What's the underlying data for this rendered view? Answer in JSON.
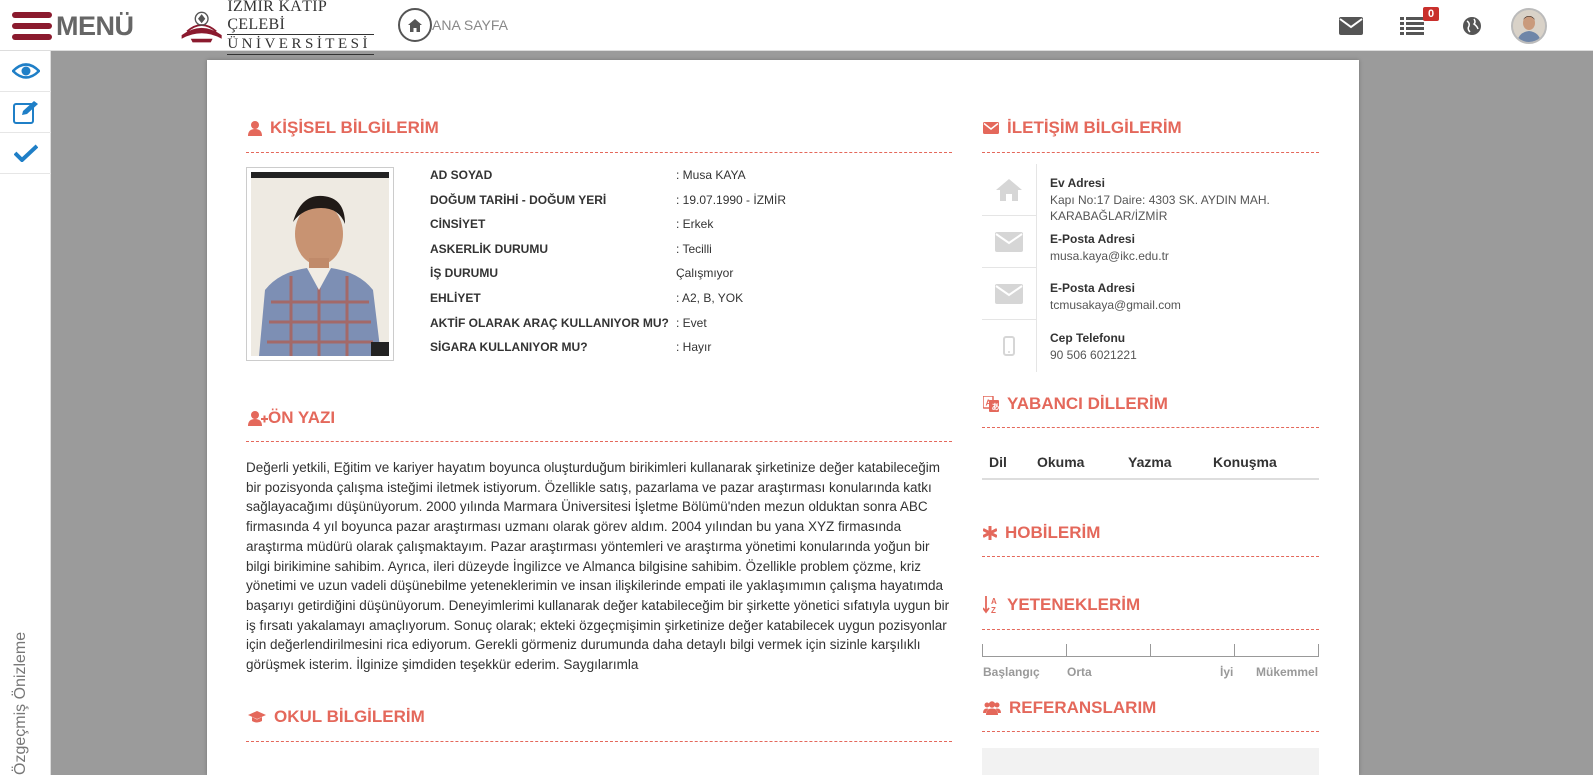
{
  "topbar": {
    "menu_label": "MENÜ",
    "logo_line1": "İZMİR KÂTİP ÇELEBİ",
    "logo_line2": "ÜNİVERSİTESİ",
    "home_label": "ANA SAYFA",
    "notifications_count": "0",
    "icons": [
      "envelope-icon",
      "list-icon",
      "globe-icon"
    ]
  },
  "sidebar": {
    "items": [
      "eye-icon",
      "edit-icon",
      "check-icon"
    ],
    "vertical_label": "Özgeçmiş Önizleme"
  },
  "personal": {
    "title": "KİŞİSEL BİLGİLERİM",
    "rows": [
      {
        "label": "AD SOYAD",
        "value": ": Musa KAYA"
      },
      {
        "label": "DOĞUM TARİHİ - DOĞUM YERİ",
        "value": ": 19.07.1990 - İZMİR"
      },
      {
        "label": "CİNSİYET",
        "value": ": Erkek"
      },
      {
        "label": "ASKERLİK DURUMU",
        "value": ": Tecilli"
      },
      {
        "label": "İŞ DURUMU",
        "value": " Çalışmıyor"
      },
      {
        "label": "EHLİYET",
        "value": " : A2, B, YOK"
      },
      {
        "label": "AKTİF OLARAK ARAÇ KULLANIYOR MU?",
        "value": ": Evet"
      },
      {
        "label": "SİGARA KULLANIYOR MU?",
        "value": ": Hayır"
      }
    ]
  },
  "cover_letter": {
    "title": "ÖN YAZI",
    "text": "Değerli yetkili, Eğitim ve kariyer hayatım boyunca oluşturduğum birikimleri kullanarak şirketinize değer katabileceğim bir pozisyonda çalışma isteğimi iletmek istiyorum. Özellikle satış, pazarlama ve pazar araştırması konularında katkı sağlayacağımı düşünüyorum. 2000 yılında Marmara Üniversitesi İşletme Bölümü'nden mezun olduktan sonra ABC firmasında 4 yıl boyunca pazar araştırması uzmanı olarak görev aldım. 2004 yılından bu yana XYZ firmasında araştırma müdürü olarak çalışmaktayım. Pazar araştırması yöntemleri ve araştırma yönetimi konularında yoğun bir bilgi birikimine sahibim. Ayrıca, ileri düzeyde İngilizce ve Almanca bilgisine sahibim. Özellikle problem çözme, kriz yönetimi ve uzun vadeli düşünebilme yeteneklerimin ve insan ilişkilerinde empati ile yaklaşımımın çalışma hayatımda başarıyı getirdiğini düşünüyorum. Deneyimlerimi kullanarak değer katabileceğim bir şirkette yönetici sıfatıyla uygun bir iş fırsatı yakalamayı amaçlıyorum. Sonuç olarak; ekteki özgeçmişimin şirketinize değer katabilecek uygun pozisyonlar için değerlendirilmesini rica ediyorum. Gerekli görmeniz durumunda daha detaylı bilgi vermek için sizinle karşılıklı görüşmek isterim. İlginize şimdiden teşekkür ederim. Saygılarımla"
  },
  "school": {
    "title": "OKUL BİLGİLERİM"
  },
  "contact": {
    "title": "İLETİŞİM BİLGİLERİM",
    "items": [
      {
        "icon": "home-icon",
        "label": "Ev Adresi",
        "value": "Kapı No:17 Daire: 4303 SK. AYDIN MAH. KARABAĞLAR/İZMİR"
      },
      {
        "icon": "envelope-icon",
        "label": "E-Posta Adresi",
        "value": "musa.kaya@ikc.edu.tr"
      },
      {
        "icon": "envelope-icon",
        "label": "E-Posta Adresi",
        "value": "tcmusakaya@gmail.com"
      },
      {
        "icon": "mobile-icon",
        "label": "Cep Telefonu",
        "value": "90 506 6021221"
      }
    ]
  },
  "languages": {
    "title": "YABANCI DİLLERİM",
    "columns": [
      "Dil",
      "Okuma",
      "Yazma",
      "Konuşma"
    ]
  },
  "hobbies": {
    "title": "HOBİLERİM"
  },
  "skills": {
    "title": "YETENEKLERİM",
    "scale": [
      "Başlangıç",
      "Orta",
      "İyi",
      "Mükemmel"
    ]
  },
  "references": {
    "title": "REFERANSLARIM"
  },
  "colors": {
    "accent": "#e4685b",
    "brand": "#8b1a2e"
  }
}
